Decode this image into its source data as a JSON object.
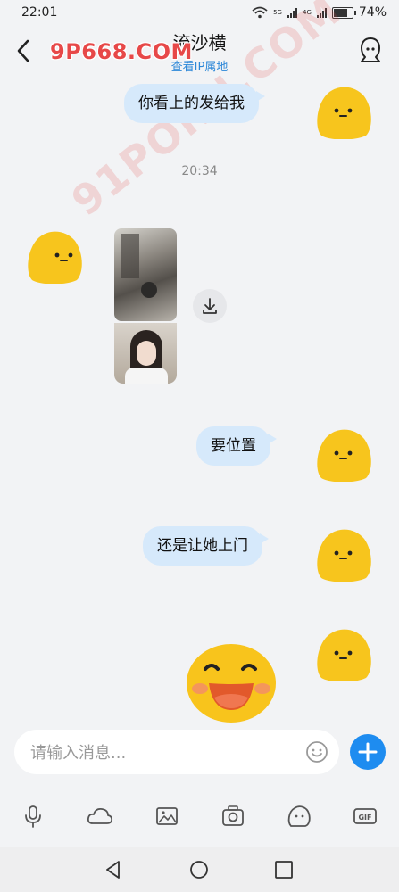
{
  "status": {
    "time": "22:01",
    "net1": "5G",
    "net2": "4G",
    "battery": "74%"
  },
  "header": {
    "title": "流沙横",
    "subtitle": "查看IP属地",
    "watermark": "9P668.COM"
  },
  "overlay_watermark": "91PORN.COM",
  "messages": [
    {
      "text": "你看上的发给我"
    },
    {
      "text": "要位置"
    },
    {
      "text": "还是让她上门"
    }
  ],
  "timestamp": "20:34",
  "input": {
    "placeholder": "请输入消息..."
  },
  "toolbar": {
    "icons": [
      "mic-icon",
      "cloud-icon",
      "image-icon",
      "camera-icon",
      "emoji-icon",
      "gif-icon"
    ]
  },
  "colors": {
    "accent": "#1e8cf0",
    "bubble": "#d6e9fb",
    "emoji_yellow": "#f7c51d"
  }
}
